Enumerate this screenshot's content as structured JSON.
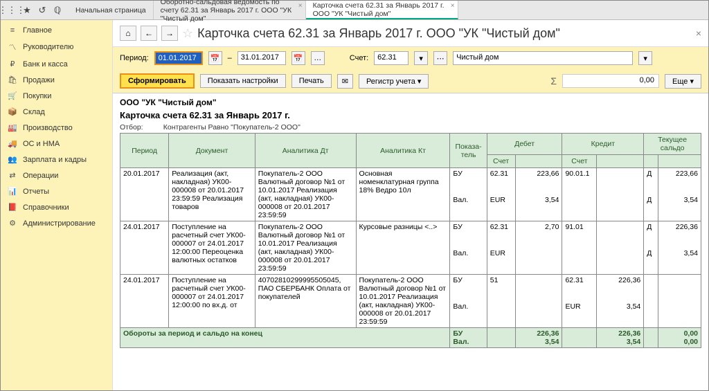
{
  "tabs": {
    "t1": "Начальная страница",
    "t2": "Оборотно-сальдовая ведомость по счету 62.31 за Январь 2017 г. ООО \"УК \"Чистый дом\"",
    "t3": "Карточка счета 62.31 за Январь 2017 г. ООО \"УК \"Чистый дом\""
  },
  "nav": {
    "n1": "Главное",
    "n2": "Руководителю",
    "n3": "Банк и касса",
    "n4": "Продажи",
    "n5": "Покупки",
    "n6": "Склад",
    "n7": "Производство",
    "n8": "ОС и НМА",
    "n9": "Зарплата и кадры",
    "n10": "Операции",
    "n11": "Отчеты",
    "n12": "Справочники",
    "n13": "Администрирование"
  },
  "hdr": {
    "title": "Карточка счета 62.31 за Январь 2017 г. ООО \"УК \"Чистый дом\""
  },
  "params": {
    "period_label": "Период:",
    "from": "01.01.2017",
    "dash": "–",
    "to": "31.01.2017",
    "acct_label": "Счет:",
    "acct": "62.31",
    "org": "Чистый дом"
  },
  "toolbar": {
    "form": "Сформировать",
    "settings": "Показать настройки",
    "print": "Печать",
    "register": "Регистр учета",
    "sum": "0,00",
    "more": "Еще"
  },
  "report": {
    "org": "ООО \"УК \"Чистый дом\"",
    "title": "Карточка счета 62.31 за Январь 2017 г.",
    "filter_label": "Отбор:",
    "filter_value": "Контрагенты Равно \"Покупатель-2 ООО\"",
    "cols": {
      "period": "Период",
      "doc": "Документ",
      "andt": "Аналитика Дт",
      "ankt": "Аналитика Кт",
      "ind": "Показа-\nтель",
      "debit": "Дебет",
      "credit": "Кредит",
      "bal": "Текущее сальдо",
      "acct": "Счет"
    },
    "rows": [
      {
        "period": "20.01.2017",
        "doc": "Реализация (акт, накладная) УК00-000008 от 20.01.2017 23:59:59 Реализация товаров",
        "andt": "Покупатель-2 ООО Валютный договор №1 от 10.01.2017 Реализация (акт, накладная) УК00-000008 от 20.01.2017 23:59:59",
        "ankt": "Основная номенклатурная группа 18% Ведро 10л",
        "ind1": "БУ",
        "ind2": "Вал.",
        "d_acct": "62.31",
        "d_val": "223,66",
        "d_cur": "EUR",
        "d_cval": "3,54",
        "c_acct": "90.01.1",
        "c_val": "",
        "b1": "Д",
        "bv1": "223,66",
        "b2": "Д",
        "bv2": "3,54"
      },
      {
        "period": "24.01.2017",
        "doc": "Поступление на расчетный счет УК00-000007 от 24.01.2017 12:00:00 Переоценка валютных остатков",
        "andt": "Покупатель-2 ООО Валютный договор №1 от 10.01.2017 Реализация (акт, накладная) УК00-000008 от 20.01.2017 23:59:59",
        "ankt": "Курсовые разницы <..>",
        "ind1": "БУ",
        "ind2": "Вал.",
        "d_acct": "62.31",
        "d_val": "2,70",
        "d_cur": "EUR",
        "d_cval": "",
        "c_acct": "91.01",
        "c_val": "",
        "b1": "Д",
        "bv1": "226,36",
        "b2": "Д",
        "bv2": "3,54"
      },
      {
        "period": "24.01.2017",
        "doc": "Поступление на расчетный счет УК00-000007 от 24.01.2017 12:00:00 по вх.д.  от",
        "andt": "40702810299995505045, ПАО СБЕРБАНК Оплата от покупателей",
        "ankt": "Покупатель-2 ООО Валютный договор №1 от 10.01.2017 Реализация (акт, накладная) УК00-000008 от 20.01.2017 23:59:59",
        "ind1": "БУ",
        "ind2": "Вал.",
        "d_acct": "51",
        "d_val": "",
        "d_cur": "",
        "d_cval": "",
        "c_acct": "62.31",
        "c_val": "226,36",
        "c_cur": "EUR",
        "c_cval": "3,54",
        "b1": "",
        "bv1": "",
        "b2": "",
        "bv2": ""
      }
    ],
    "totals": {
      "label": "Обороты за период и сальдо на конец",
      "ind1": "БУ",
      "ind2": "Вал.",
      "d1": "226,36",
      "d2": "3,54",
      "c1": "226,36",
      "c2": "3,54",
      "b1": "0,00",
      "b2": "0,00"
    }
  }
}
